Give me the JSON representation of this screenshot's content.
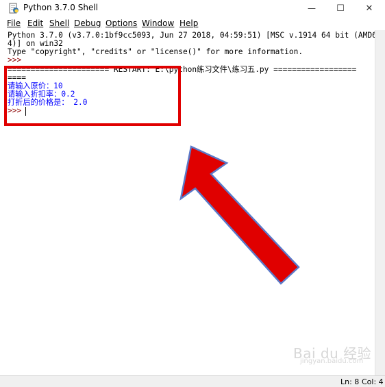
{
  "window": {
    "title": "Python 3.7.0 Shell",
    "controls": {
      "minimize": "—",
      "maximize": "☐",
      "close": "✕"
    }
  },
  "menu": {
    "items": [
      {
        "label": "File"
      },
      {
        "label": "Edit"
      },
      {
        "label": "Shell"
      },
      {
        "label": "Debug"
      },
      {
        "label": "Options"
      },
      {
        "label": "Window"
      },
      {
        "label": "Help"
      }
    ]
  },
  "shell": {
    "banner_line1": "Python 3.7.0 (v3.7.0:1bf9cc5093, Jun 27 2018, 04:59:51) [MSC v.1914 64 bit (AMD6",
    "banner_line2": "4)] on win32",
    "banner_line3": "Type \"copyright\", \"credits\" or \"license()\" for more information.",
    "prompt1": ">>>",
    "restart_line": "====================== RESTART: E:\\python练习文件\\练习五.py ==================",
    "restart_cont": "====",
    "out1": "请输入原价：10",
    "out2": "请输入折扣率：0.2",
    "out3": "打折后的价格是： 2.0",
    "prompt2": ">>>"
  },
  "status": {
    "line": "Ln: 8",
    "col": "Col: 4"
  },
  "watermark": {
    "text": "Bai du 经验",
    "sub": "jingyan.baidu.com"
  },
  "colors": {
    "annotation_red": "#e00000",
    "output_blue": "#0000ff",
    "prompt_maroon": "#8b0000"
  }
}
